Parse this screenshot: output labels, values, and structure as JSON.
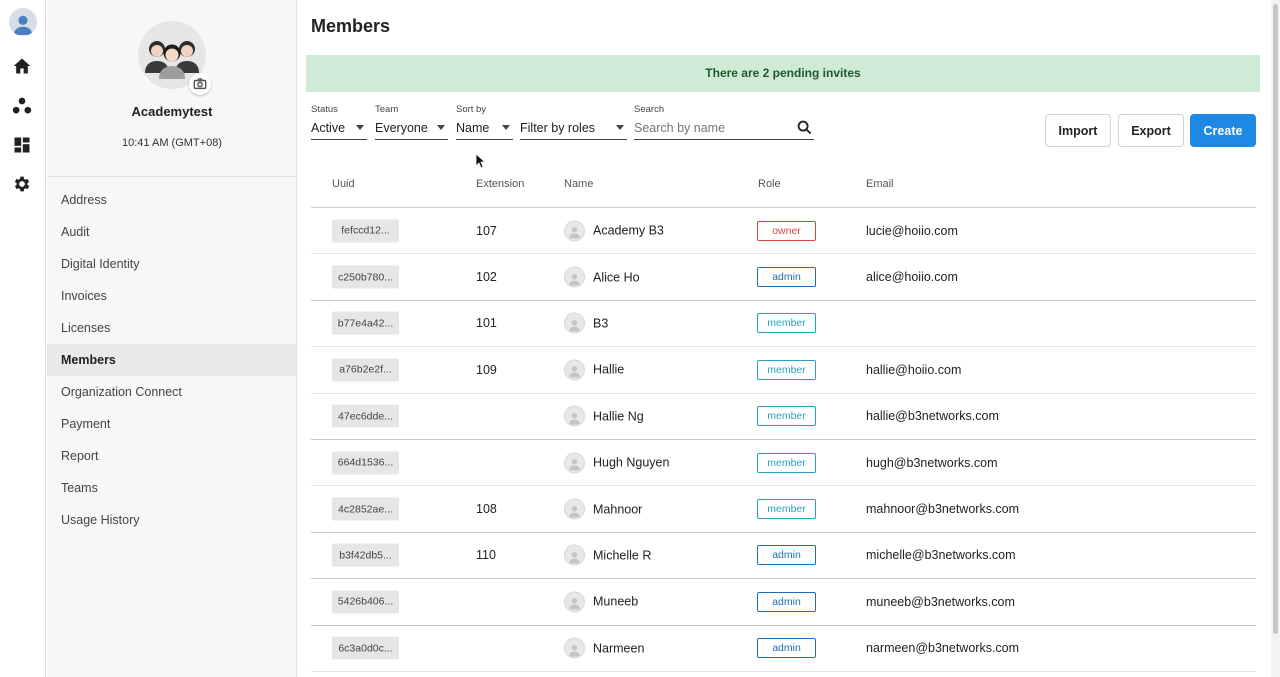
{
  "rail": {
    "items": [
      {
        "icon": "user-avatar-icon"
      },
      {
        "icon": "home-icon"
      },
      {
        "icon": "organization-icon"
      },
      {
        "icon": "dashboard-icon"
      },
      {
        "icon": "gear-icon"
      }
    ]
  },
  "org": {
    "name": "Academytest",
    "time": "10:41 AM (GMT+08)",
    "nav": [
      {
        "label": "Address",
        "active": false
      },
      {
        "label": "Audit",
        "active": false
      },
      {
        "label": "Digital Identity",
        "active": false
      },
      {
        "label": "Invoices",
        "active": false
      },
      {
        "label": "Licenses",
        "active": false
      },
      {
        "label": "Members",
        "active": true
      },
      {
        "label": "Organization Connect",
        "active": false
      },
      {
        "label": "Payment",
        "active": false
      },
      {
        "label": "Report",
        "active": false
      },
      {
        "label": "Teams",
        "active": false
      },
      {
        "label": "Usage History",
        "active": false
      }
    ]
  },
  "page": {
    "title": "Members",
    "banner": "There are 2 pending invites"
  },
  "filters": {
    "status": {
      "label": "Status",
      "value": "Active"
    },
    "team": {
      "label": "Team",
      "value": "Everyone"
    },
    "sort": {
      "label": "Sort by",
      "value": "Name"
    },
    "roles": {
      "value": "Filter by roles"
    },
    "search": {
      "label": "Search",
      "placeholder": "Search by name",
      "value": ""
    }
  },
  "actions": {
    "import": "Import",
    "export": "Export",
    "create": "Create"
  },
  "table": {
    "columns": [
      "Uuid",
      "Extension",
      "Name",
      "Role",
      "Email"
    ],
    "rows": [
      {
        "uuid": "fefccd12...",
        "ext": "107",
        "name": "Academy B3",
        "role": "owner",
        "email": "lucie@hoiio.com"
      },
      {
        "uuid": "c250b780...",
        "ext": "102",
        "name": "Alice Ho",
        "role": "admin",
        "email": "alice@hoiio.com"
      },
      {
        "uuid": "b77e4a42...",
        "ext": "101",
        "name": "B3",
        "role": "member",
        "email": ""
      },
      {
        "uuid": "a76b2e2f...",
        "ext": "109",
        "name": "Hallie",
        "role": "member",
        "email": "hallie@hoiio.com"
      },
      {
        "uuid": "47ec6dde...",
        "ext": "",
        "name": "Hallie Ng",
        "role": "member",
        "email": "hallie@b3networks.com"
      },
      {
        "uuid": "664d1536...",
        "ext": "",
        "name": "Hugh Nguyen",
        "role": "member",
        "email": "hugh@b3networks.com"
      },
      {
        "uuid": "4c2852ae...",
        "ext": "108",
        "name": "Mahnoor",
        "role": "member",
        "email": "mahnoor@b3networks.com"
      },
      {
        "uuid": "b3f42db5...",
        "ext": "110",
        "name": "Michelle R",
        "role": "admin",
        "email": "michelle@b3networks.com"
      },
      {
        "uuid": "5426b406...",
        "ext": "",
        "name": "Muneeb",
        "role": "admin",
        "email": "muneeb@b3networks.com"
      },
      {
        "uuid": "6c3a0d0c...",
        "ext": "",
        "name": "Narmeen",
        "role": "admin",
        "email": "narmeen@b3networks.com"
      }
    ]
  },
  "colors": {
    "primary": "#1e88e5",
    "banner_bg": "#cfead5",
    "owner": "#d64545",
    "admin": "#1e6fb5",
    "member": "#2ca0bb"
  }
}
